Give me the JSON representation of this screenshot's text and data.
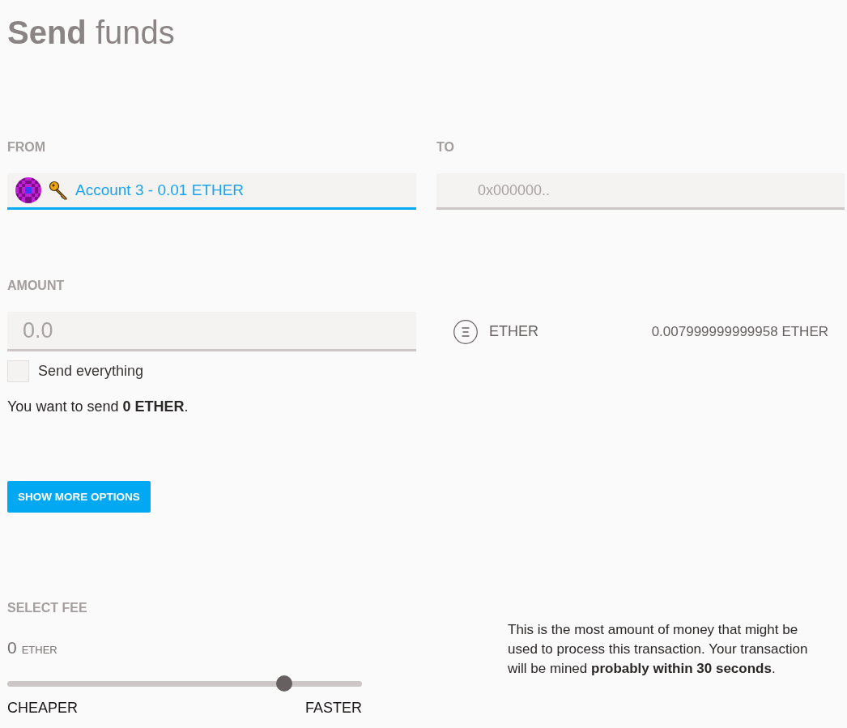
{
  "title": "**Send** funds",
  "from": {
    "label": "FROM",
    "account": "Account 3 - 0.01 ETHER",
    "focused": true
  },
  "to": {
    "label": "TO",
    "placeholder": "0x000000.."
  },
  "amount": {
    "label": "AMOUNT",
    "placeholder": "0.0",
    "send_everything": {
      "label": "Send everything",
      "checked": false
    },
    "summary": "You want to send **0 ETHER**."
  },
  "currency": {
    "name": "ETHER",
    "balance": "0.007999999999958 ETHER"
  },
  "more_options_button": "SHOW MORE OPTIONS",
  "fee": {
    "label": "SELECT FEE",
    "amount": "0",
    "unit": "ETHER",
    "level": 0.78,
    "min_label": "CHEAPER",
    "max_label": "FASTER",
    "note": "This is the most amount of money that might be used to process this transaction. Your transaction will be mined **probably within 30 seconds**."
  }
}
